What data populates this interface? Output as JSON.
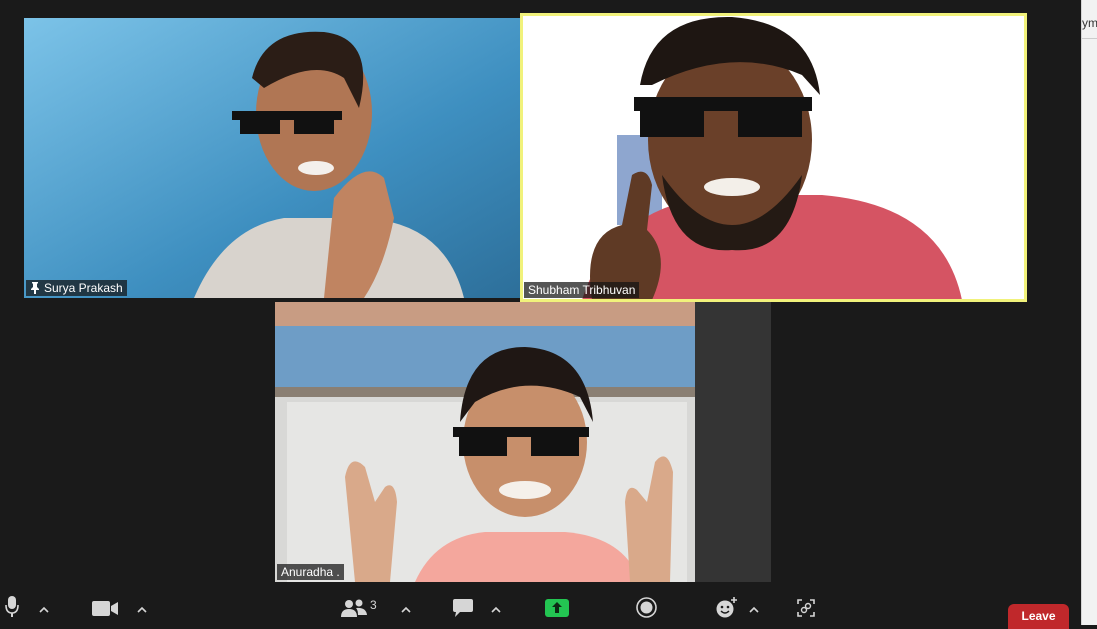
{
  "participants": [
    {
      "name": "Surya Prakash",
      "pinned": true,
      "active_speaker": false
    },
    {
      "name": "Shubham Tribhuvan",
      "pinned": false,
      "active_speaker": true
    },
    {
      "name": "Anuradha .",
      "pinned": false,
      "active_speaker": false
    }
  ],
  "toolbar": {
    "participants_count": "3",
    "leave_label": "Leave"
  },
  "side_window": {
    "text_fragment": "ym"
  },
  "colors": {
    "background": "#1a1a1a",
    "active_speaker_border": "#f1f27b",
    "share_screen": "#23c552",
    "leave": "#c0282b"
  },
  "icons": [
    "microphone-icon",
    "video-camera-icon",
    "participants-icon",
    "chat-icon",
    "share-screen-icon",
    "record-icon",
    "reactions-icon",
    "apps-icon",
    "caret-up-icon",
    "pin-icon"
  ]
}
